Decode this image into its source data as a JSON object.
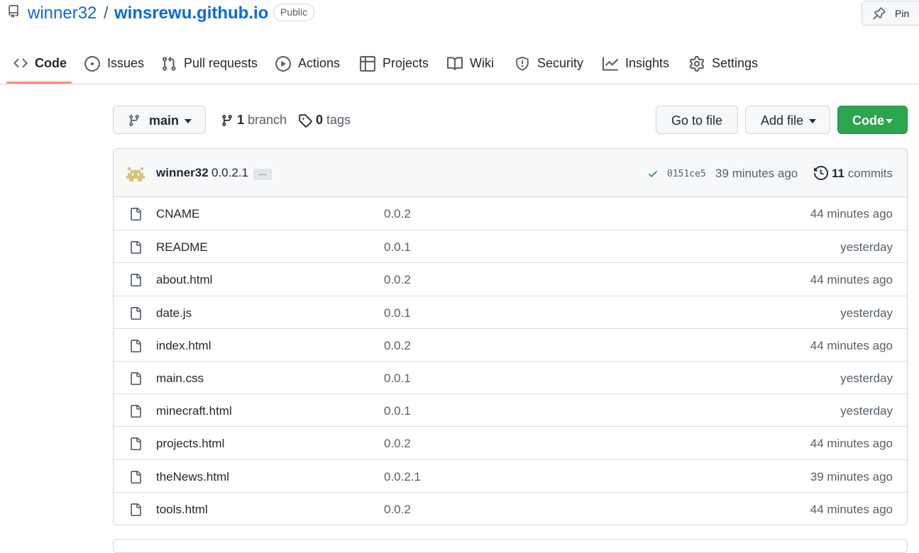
{
  "repo": {
    "owner": "winner32",
    "separator": "/",
    "name": "winsrewu.github.io",
    "visibility": "Public",
    "pin_label": "Pin"
  },
  "tabs": [
    {
      "label": "Code",
      "icon": "code-icon",
      "active": true
    },
    {
      "label": "Issues",
      "icon": "issue-icon"
    },
    {
      "label": "Pull requests",
      "icon": "pull-request-icon"
    },
    {
      "label": "Actions",
      "icon": "play-icon"
    },
    {
      "label": "Projects",
      "icon": "table-icon"
    },
    {
      "label": "Wiki",
      "icon": "book-icon"
    },
    {
      "label": "Security",
      "icon": "shield-icon"
    },
    {
      "label": "Insights",
      "icon": "graph-icon"
    },
    {
      "label": "Settings",
      "icon": "gear-icon"
    }
  ],
  "toolbar": {
    "branch": "main",
    "branch_count": "1",
    "branch_word": "branch",
    "tag_count": "0",
    "tag_word": "tags",
    "go_to_file": "Go to file",
    "add_file": "Add file",
    "code": "Code"
  },
  "latest_commit": {
    "author": "winner32",
    "message": "0.0.2.1",
    "ellipsis": "…",
    "sha": "0151ce5",
    "time": "39 minutes ago",
    "commit_count": "11",
    "commit_word": "commits"
  },
  "files": [
    {
      "name": "CNAME",
      "message": "0.0.2",
      "time": "44 minutes ago"
    },
    {
      "name": "README",
      "message": "0.0.1",
      "time": "yesterday"
    },
    {
      "name": "about.html",
      "message": "0.0.2",
      "time": "44 minutes ago"
    },
    {
      "name": "date.js",
      "message": "0.0.1",
      "time": "yesterday"
    },
    {
      "name": "index.html",
      "message": "0.0.2",
      "time": "44 minutes ago"
    },
    {
      "name": "main.css",
      "message": "0.0.1",
      "time": "yesterday"
    },
    {
      "name": "minecraft.html",
      "message": "0.0.1",
      "time": "yesterday"
    },
    {
      "name": "projects.html",
      "message": "0.0.2",
      "time": "44 minutes ago"
    },
    {
      "name": "theNews.html",
      "message": "0.0.2.1",
      "time": "39 minutes ago"
    },
    {
      "name": "tools.html",
      "message": "0.0.2",
      "time": "44 minutes ago"
    }
  ],
  "colors": {
    "link": "#0969da",
    "tab_underline": "#fd8c73",
    "primary_button": "#2da44e",
    "success_check": "#1a7f37"
  }
}
